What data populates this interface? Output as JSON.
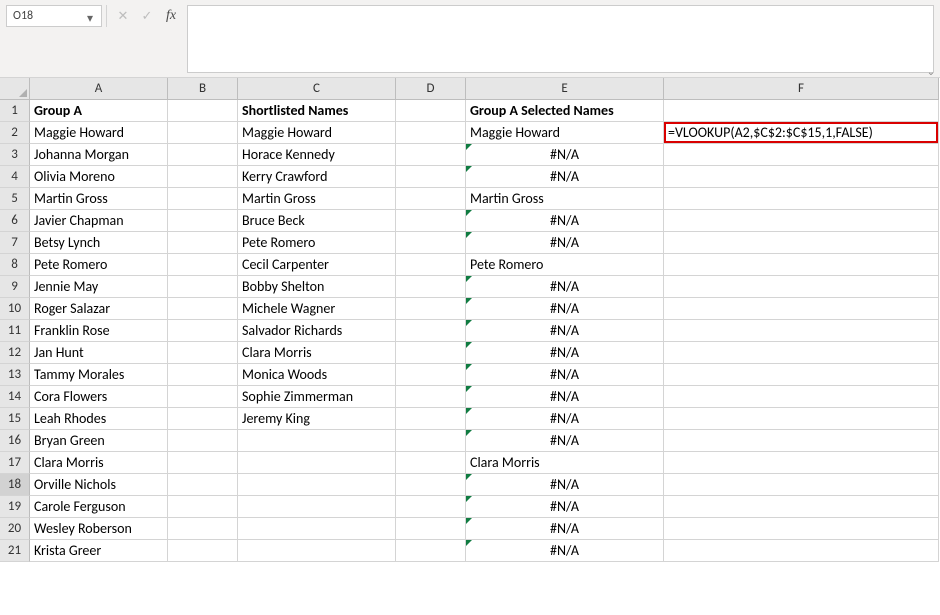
{
  "nameBox": {
    "value": "O18"
  },
  "formulaBar": {
    "value": ""
  },
  "icons": {
    "cancel": "✕",
    "enter": "✓",
    "fx": "fx",
    "dropdown": "▾",
    "expand": "⌄"
  },
  "columns": [
    "A",
    "B",
    "C",
    "D",
    "E",
    "F"
  ],
  "headerRow": {
    "A": "Group A",
    "C": "Shortlisted Names",
    "E": "Group A Selected Names"
  },
  "f2": "=VLOOKUP(A2,$C$2:$C$15,1,FALSE)",
  "rows": [
    {
      "n": 2,
      "A": "Maggie Howard",
      "C": "Maggie Howard",
      "E": "Maggie Howard",
      "Eerr": false
    },
    {
      "n": 3,
      "A": "Johanna Morgan",
      "C": "Horace Kennedy",
      "E": "#N/A",
      "Eerr": true
    },
    {
      "n": 4,
      "A": "Olivia Moreno",
      "C": "Kerry Crawford",
      "E": "#N/A",
      "Eerr": true
    },
    {
      "n": 5,
      "A": "Martin Gross",
      "C": "Martin Gross",
      "E": "Martin Gross",
      "Eerr": false
    },
    {
      "n": 6,
      "A": "Javier Chapman",
      "C": "Bruce Beck",
      "E": "#N/A",
      "Eerr": true
    },
    {
      "n": 7,
      "A": "Betsy Lynch",
      "C": "Pete Romero",
      "E": "#N/A",
      "Eerr": true
    },
    {
      "n": 8,
      "A": "Pete Romero",
      "C": "Cecil Carpenter",
      "E": "Pete Romero",
      "Eerr": false
    },
    {
      "n": 9,
      "A": "Jennie May",
      "C": "Bobby Shelton",
      "E": "#N/A",
      "Eerr": true
    },
    {
      "n": 10,
      "A": "Roger Salazar",
      "C": "Michele Wagner",
      "E": "#N/A",
      "Eerr": true
    },
    {
      "n": 11,
      "A": "Franklin Rose",
      "C": "Salvador Richards",
      "E": "#N/A",
      "Eerr": true
    },
    {
      "n": 12,
      "A": "Jan Hunt",
      "C": "Clara Morris",
      "E": "#N/A",
      "Eerr": true
    },
    {
      "n": 13,
      "A": "Tammy Morales",
      "C": "Monica Woods",
      "E": "#N/A",
      "Eerr": true
    },
    {
      "n": 14,
      "A": "Cora Flowers",
      "C": "Sophie Zimmerman",
      "E": "#N/A",
      "Eerr": true
    },
    {
      "n": 15,
      "A": "Leah Rhodes",
      "C": "Jeremy King",
      "E": "#N/A",
      "Eerr": true
    },
    {
      "n": 16,
      "A": "Bryan Green",
      "C": "",
      "E": "#N/A",
      "Eerr": true
    },
    {
      "n": 17,
      "A": "Clara Morris",
      "C": "",
      "E": "Clara Morris",
      "Eerr": false
    },
    {
      "n": 18,
      "A": "Orville Nichols",
      "C": "",
      "E": "#N/A",
      "Eerr": true,
      "sel": true
    },
    {
      "n": 19,
      "A": "Carole Ferguson",
      "C": "",
      "E": "#N/A",
      "Eerr": true
    },
    {
      "n": 20,
      "A": "Wesley Roberson",
      "C": "",
      "E": "#N/A",
      "Eerr": true
    },
    {
      "n": 21,
      "A": "Krista Greer",
      "C": "",
      "E": "#N/A",
      "Eerr": true
    }
  ]
}
